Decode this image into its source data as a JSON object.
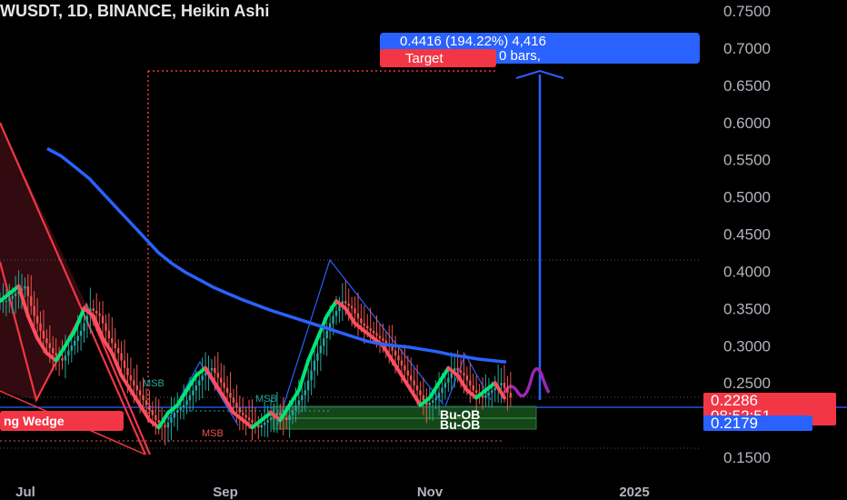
{
  "chart_data": {
    "type": "candlestick",
    "title": "WUSDT, 1D, BINANCE, Heikin Ashi",
    "price_ticks": [
      0.75,
      0.7,
      0.65,
      0.6,
      0.55,
      0.5,
      0.45,
      0.4,
      0.35,
      0.3,
      0.25,
      0.15
    ],
    "price_tick_labels": [
      "0.7500",
      "0.7000",
      "0.6500",
      "0.6000",
      "0.5500",
      "0.5000",
      "0.4500",
      "0.4000",
      "0.3500",
      "0.3000",
      "0.2500",
      "0.1500"
    ],
    "ylim": [
      0.14,
      0.76
    ],
    "x_ticks": [
      "Jul",
      "Sep",
      "Nov",
      "2025"
    ],
    "last_price": "0.2286",
    "countdown": "08:52:51",
    "support_price": "0.2179",
    "target_label": "Target",
    "measure_text_1": "0.4416 (194.22%) 4,416",
    "measure_text_2": "0 bars,",
    "pattern_label": "ng Wedge",
    "order_block_labels": [
      "Bu-OB",
      "Bu-OB"
    ],
    "msb_labels": [
      "MSB",
      "MSB",
      "MSB"
    ],
    "colors": {
      "up": "#26a69a",
      "down": "#ef5350",
      "ma": "#2962ff",
      "target": "#f23645",
      "measure": "#2962ff",
      "forecast": "#9c27b0",
      "ob": "#1b5e20"
    },
    "ma_series": [
      [
        0.565,
        0.555,
        0.54,
        0.525,
        0.505,
        0.485,
        0.465,
        0.445,
        0.425,
        0.41,
        0.398,
        0.388,
        0.378,
        0.37,
        0.362,
        0.355,
        0.348,
        0.342,
        0.336,
        0.33,
        0.324,
        0.318,
        0.312,
        0.306,
        0.302,
        0.3,
        0.298,
        0.295,
        0.292,
        0.288,
        0.285,
        0.282,
        0.28,
        0.278
      ]
    ],
    "price_series": [
      0.36,
      0.37,
      0.38,
      0.34,
      0.31,
      0.29,
      0.28,
      0.3,
      0.32,
      0.35,
      0.34,
      0.31,
      0.29,
      0.26,
      0.24,
      0.22,
      0.2,
      0.19,
      0.21,
      0.22,
      0.24,
      0.26,
      0.27,
      0.25,
      0.23,
      0.21,
      0.2,
      0.19,
      0.2,
      0.21,
      0.2,
      0.22,
      0.24,
      0.28,
      0.31,
      0.34,
      0.36,
      0.35,
      0.33,
      0.32,
      0.31,
      0.3,
      0.28,
      0.26,
      0.24,
      0.22,
      0.23,
      0.25,
      0.27,
      0.26,
      0.24,
      0.23,
      0.24,
      0.25,
      0.23
    ]
  }
}
